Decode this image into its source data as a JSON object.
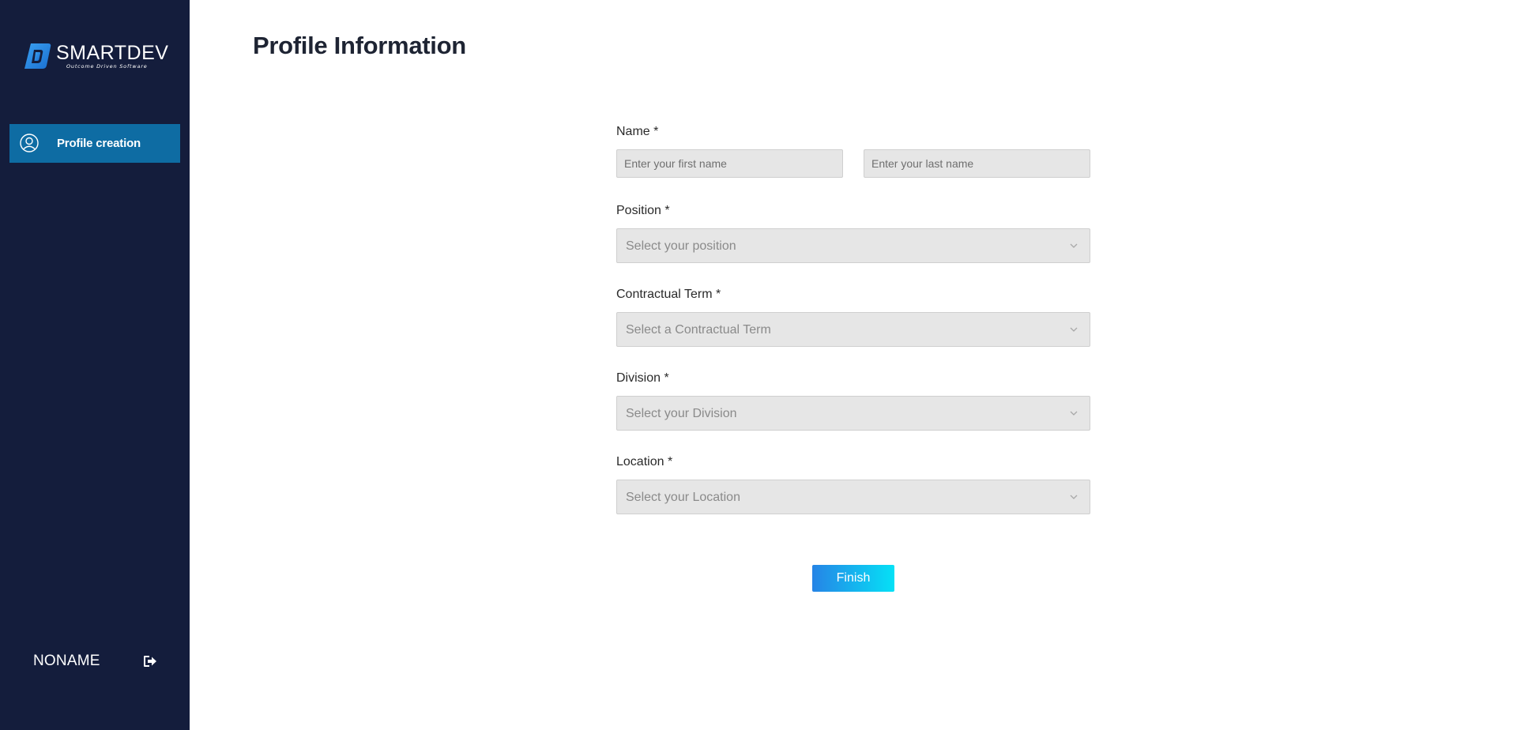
{
  "brand": {
    "name": "SMARTDEV",
    "tagline": "Outcome Driven Software",
    "logo_icon": "smartdev-logo-icon",
    "colors": {
      "sidebar_bg": "#141d3c",
      "nav_active_bg": "#0e6ca3",
      "button_gradient_start": "#2684e6",
      "button_gradient_end": "#05e1f6"
    }
  },
  "sidebar": {
    "items": [
      {
        "label": "Profile creation",
        "icon": "user-circle-icon",
        "active": true
      }
    ],
    "user": {
      "name": "NONAME",
      "logout_icon": "logout-icon"
    }
  },
  "main": {
    "title": "Profile Information",
    "form": {
      "name": {
        "label": "Name *",
        "first_placeholder": "Enter your first name",
        "last_placeholder": "Enter your last name",
        "first_value": "",
        "last_value": ""
      },
      "position": {
        "label": "Position *",
        "placeholder": "Select your position"
      },
      "contractual_term": {
        "label": "Contractual Term *",
        "placeholder": "Select a Contractual Term"
      },
      "division": {
        "label": "Division *",
        "placeholder": "Select your Division"
      },
      "location": {
        "label": "Location *",
        "placeholder": "Select your Location"
      },
      "submit_label": "Finish"
    }
  }
}
